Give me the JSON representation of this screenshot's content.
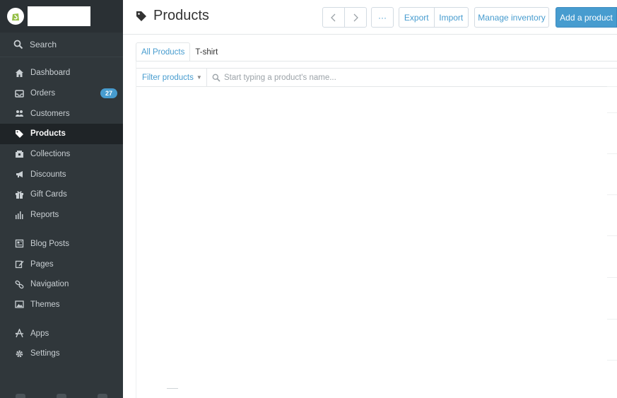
{
  "sidebar": {
    "search_label": "Search",
    "items": [
      {
        "label": "Dashboard",
        "icon": "home-icon"
      },
      {
        "label": "Orders",
        "icon": "inbox-icon",
        "badge": "27"
      },
      {
        "label": "Customers",
        "icon": "customers-icon"
      },
      {
        "label": "Products",
        "icon": "tag-icon",
        "active": true
      },
      {
        "label": "Collections",
        "icon": "collections-icon"
      },
      {
        "label": "Discounts",
        "icon": "megaphone-icon"
      },
      {
        "label": "Gift Cards",
        "icon": "gift-icon"
      },
      {
        "label": "Reports",
        "icon": "bar-chart-icon"
      },
      {
        "label": "Blog Posts",
        "icon": "blog-icon"
      },
      {
        "label": "Pages",
        "icon": "pages-icon"
      },
      {
        "label": "Navigation",
        "icon": "link-icon"
      },
      {
        "label": "Themes",
        "icon": "image-icon"
      },
      {
        "label": "Apps",
        "icon": "apps-icon"
      },
      {
        "label": "Settings",
        "icon": "gear-icon"
      }
    ]
  },
  "header": {
    "title": "Products",
    "more_label": "···",
    "export_label": "Export",
    "import_label": "Import",
    "manage_inventory_label": "Manage inventory",
    "add_product_label": "Add a product"
  },
  "tabs": [
    {
      "label": "All Products",
      "active": true
    },
    {
      "label": "T-shirt",
      "active": false
    }
  ],
  "filter": {
    "button_label": "Filter products",
    "search_placeholder": "Start typing a product's name...",
    "search_value": ""
  },
  "colors": {
    "sidebar_bg": "#30373b",
    "accent": "#479ccf",
    "active_bg": "#1f2427"
  }
}
